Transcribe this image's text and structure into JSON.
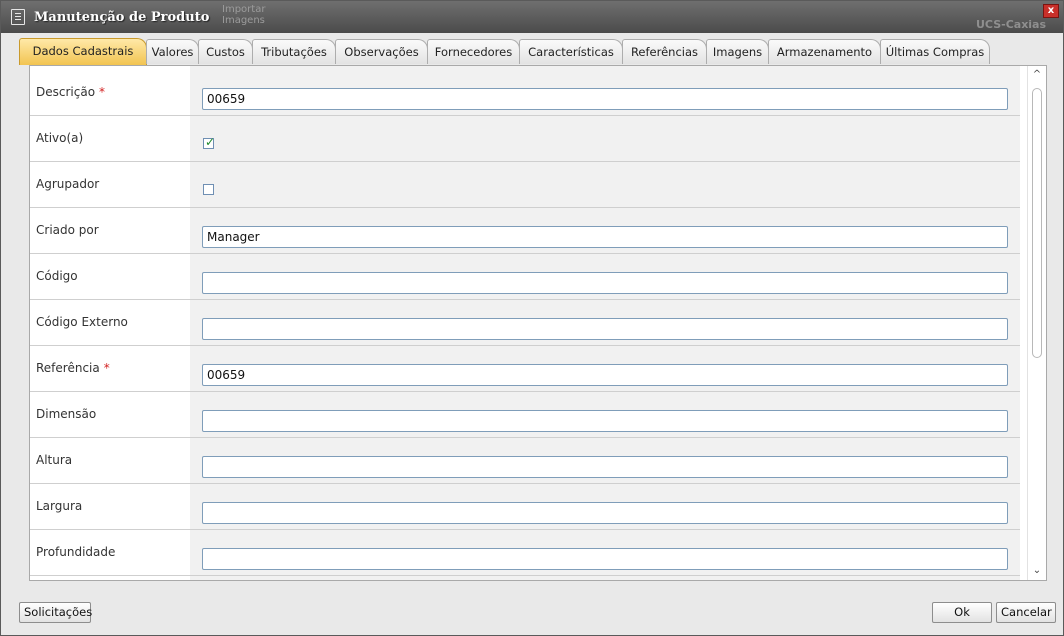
{
  "window": {
    "title": "Manutenção de Produto",
    "close_glyph": "x",
    "background_fragments": [
      "Importar",
      "Imagens",
      "UCS-Caxias"
    ]
  },
  "tabs": [
    {
      "label": "Dados Cadastrais",
      "active": true
    },
    {
      "label": "Valores"
    },
    {
      "label": "Custos"
    },
    {
      "label": "Tributações"
    },
    {
      "label": "Observações"
    },
    {
      "label": "Fornecedores"
    },
    {
      "label": "Características"
    },
    {
      "label": "Referências"
    },
    {
      "label": "Imagens"
    },
    {
      "label": "Armazenamento"
    },
    {
      "label": "Últimas Compras"
    }
  ],
  "form": {
    "required_marker": "*",
    "rows": [
      {
        "label": "Descrição",
        "required": true,
        "type": "text",
        "value": "00659"
      },
      {
        "label": "Ativo(a)",
        "type": "checkbox",
        "checked": true
      },
      {
        "label": "Agrupador",
        "type": "checkbox",
        "checked": false
      },
      {
        "label": "Criado por",
        "type": "text",
        "value": "Manager"
      },
      {
        "label": "Código",
        "type": "text",
        "value": ""
      },
      {
        "label": "Código Externo",
        "type": "text",
        "value": ""
      },
      {
        "label": "Referência",
        "required": true,
        "type": "text",
        "value": "00659"
      },
      {
        "label": "Dimensão",
        "type": "text",
        "value": ""
      },
      {
        "label": "Altura",
        "type": "text",
        "value": ""
      },
      {
        "label": "Largura",
        "type": "text",
        "value": ""
      },
      {
        "label": "Profundidade",
        "type": "text",
        "value": ""
      }
    ],
    "checkmark": "✓"
  },
  "scroll": {
    "up": "^",
    "down": "⌄"
  },
  "footer": {
    "solicitacoes_label": "Solicitações",
    "ok_label": "Ok",
    "cancel_label": "Cancelar"
  },
  "colors": {
    "active_tab": "#f2c451",
    "required": "#d21f1f",
    "checkmark": "#1f8a2b"
  }
}
